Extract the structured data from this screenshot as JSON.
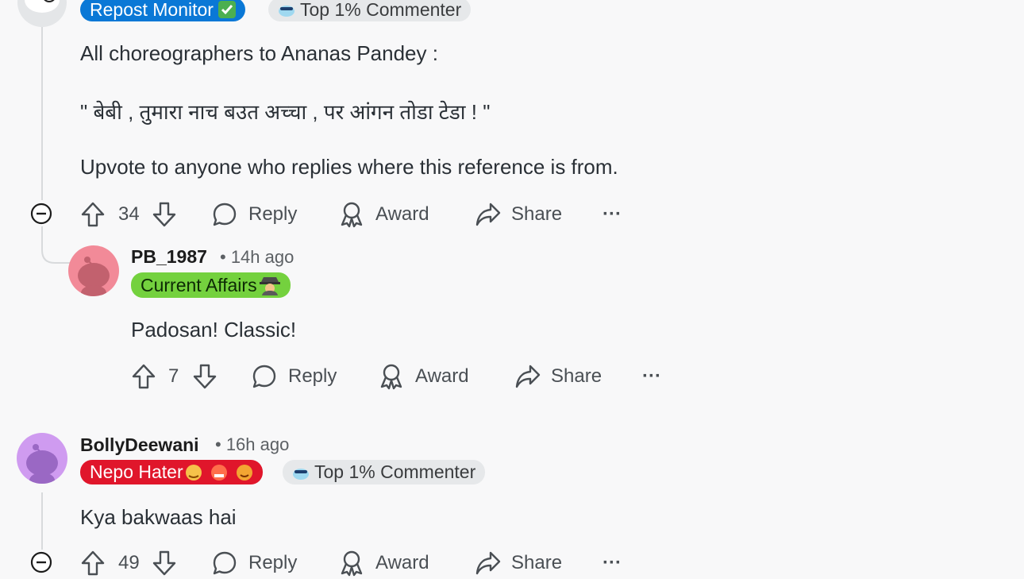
{
  "comment1": {
    "flairs": [
      "Repost Monitor",
      "Top 1% Commenter"
    ],
    "lines": [
      "All choreographers to Ananas Pandey :",
      "\" बेबी , तुमारा नाच बउत अच्चा , पर आंगन तोडा टेडा ! \"",
      "Upvote to anyone who replies where this reference is from."
    ],
    "votes": "34"
  },
  "reply1": {
    "username": "PB_1987",
    "time": "• 14h ago",
    "flair": "Current Affairs",
    "text": "Padosan! Classic!",
    "votes": "7"
  },
  "comment2": {
    "username": "BollyDeewani",
    "time": "• 16h ago",
    "flair": "Nepo Hater",
    "flair2": "Top 1% Commenter",
    "text": "Kya bakwaas hai",
    "votes": "49"
  },
  "actions": {
    "reply": "Reply",
    "award": "Award",
    "share": "Share",
    "more": "···"
  },
  "colors": {
    "background": "#f8f8f9",
    "repost_flair": "#0a78d6",
    "current_affairs_flair": "#74d13e",
    "nepo_flair": "#e0162b",
    "avatar_pink": "#f28a98",
    "avatar_purple": "#cf9bf0"
  },
  "icons": [
    "snoo-avatar",
    "upvote-icon",
    "downvote-icon",
    "reply-icon",
    "award-icon",
    "share-icon",
    "collapse-icon",
    "checkmark-icon"
  ]
}
